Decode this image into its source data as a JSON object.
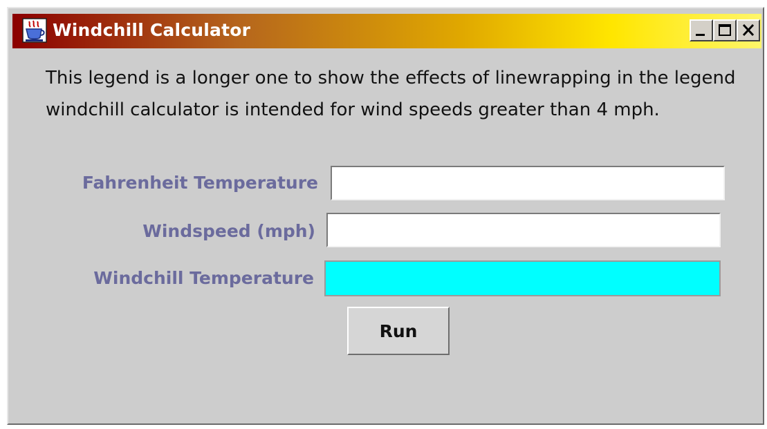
{
  "window": {
    "title": "Windchill Calculator",
    "icons": {
      "app": "java-coffee-cup-icon",
      "minimize": "minimize-icon",
      "maximize": "maximize-icon",
      "close": "close-icon"
    }
  },
  "legend": "This legend is a longer one to show the effects of linewrapping in the legend windchill calculator is intended for wind speeds greater than 4 mph.",
  "form": {
    "fahrenheit_label": "Fahrenheit Temperature",
    "fahrenheit_value": "",
    "windspeed_label": "Windspeed (mph)",
    "windspeed_value": "",
    "windchill_label": "Windchill Temperature",
    "windchill_value": ""
  },
  "actions": {
    "run_label": "Run"
  },
  "colors": {
    "label_text": "#6b6b9d",
    "output_field": "#00ffff",
    "window_bg": "#cdcdcd"
  }
}
